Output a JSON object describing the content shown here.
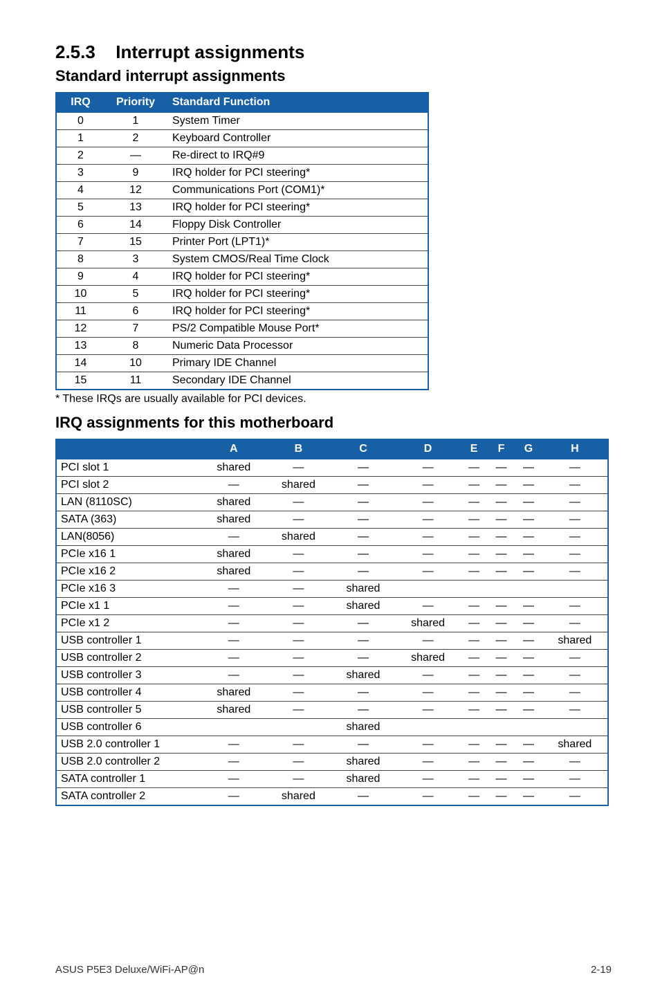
{
  "section": {
    "number": "2.5.3",
    "title": "Interrupt assignments"
  },
  "subhead1": "Standard interrupt assignments",
  "table1": {
    "headers": {
      "irq": "IRQ",
      "priority": "Priority",
      "func": "Standard Function"
    },
    "rows": [
      {
        "irq": "0",
        "pri": "1",
        "func": "System Timer"
      },
      {
        "irq": "1",
        "pri": "2",
        "func": "Keyboard Controller"
      },
      {
        "irq": "2",
        "pri": "—",
        "func": "Re-direct to IRQ#9"
      },
      {
        "irq": "3",
        "pri": "9",
        "func": "IRQ holder for PCI steering*"
      },
      {
        "irq": "4",
        "pri": "12",
        "func": "Communications Port (COM1)*"
      },
      {
        "irq": "5",
        "pri": "13",
        "func": "IRQ holder for PCI steering*"
      },
      {
        "irq": "6",
        "pri": "14",
        "func": "Floppy Disk Controller"
      },
      {
        "irq": "7",
        "pri": "15",
        "func": "Printer Port (LPT1)*"
      },
      {
        "irq": "8",
        "pri": "3",
        "func": "System CMOS/Real Time Clock"
      },
      {
        "irq": "9",
        "pri": "4",
        "func": "IRQ holder for PCI steering*"
      },
      {
        "irq": "10",
        "pri": "5",
        "func": "IRQ holder for PCI steering*"
      },
      {
        "irq": "11",
        "pri": "6",
        "func": "IRQ holder for PCI steering*"
      },
      {
        "irq": "12",
        "pri": "7",
        "func": "PS/2 Compatible Mouse Port*"
      },
      {
        "irq": "13",
        "pri": "8",
        "func": "Numeric Data Processor"
      },
      {
        "irq": "14",
        "pri": "10",
        "func": "Primary IDE Channel"
      },
      {
        "irq": "15",
        "pri": "11",
        "func": "Secondary IDE Channel"
      }
    ]
  },
  "note": "* These IRQs are usually available for PCI devices.",
  "subhead2": "IRQ assignments for this motherboard",
  "table2": {
    "headers": {
      "dev": "",
      "A": "A",
      "B": "B",
      "C": "C",
      "D": "D",
      "E": "E",
      "F": "F",
      "G": "G",
      "H": "H"
    },
    "rows": [
      {
        "dev": "PCI slot 1",
        "A": "shared",
        "B": "—",
        "C": "—",
        "D": "—",
        "E": "—",
        "F": "—",
        "G": "—",
        "H": "—"
      },
      {
        "dev": "PCI slot 2",
        "A": "—",
        "B": "shared",
        "C": "—",
        "D": "—",
        "E": "—",
        "F": "—",
        "G": "—",
        "H": "—"
      },
      {
        "dev": "LAN (8110SC)",
        "A": "shared",
        "B": "—",
        "C": "—",
        "D": "—",
        "E": "—",
        "F": "—",
        "G": "—",
        "H": "—"
      },
      {
        "dev": "SATA (363)",
        "A": "shared",
        "B": "—",
        "C": "—",
        "D": "—",
        "E": "—",
        "F": "—",
        "G": "—",
        "H": "—"
      },
      {
        "dev": "LAN(8056)",
        "A": "—",
        "B": "shared",
        "C": "—",
        "D": "—",
        "E": "—",
        "F": "—",
        "G": "—",
        "H": "—"
      },
      {
        "dev": "PCIe x16 1",
        "A": "shared",
        "B": "—",
        "C": "—",
        "D": "—",
        "E": "—",
        "F": "—",
        "G": "—",
        "H": "—"
      },
      {
        "dev": "PCIe x16 2",
        "A": "shared",
        "B": "—",
        "C": "—",
        "D": "—",
        "E": "—",
        "F": "—",
        "G": "—",
        "H": "—"
      },
      {
        "dev": "PCIe x16 3",
        "A": "—",
        "B": "—",
        "C": "shared",
        "D": "",
        "E": "",
        "F": "",
        "G": "",
        "H": ""
      },
      {
        "dev": "PCIe x1 1",
        "A": "—",
        "B": "—",
        "C": "shared",
        "D": "—",
        "E": "—",
        "F": "—",
        "G": "—",
        "H": "—"
      },
      {
        "dev": "PCIe x1 2",
        "A": "—",
        "B": "—",
        "C": "—",
        "D": "shared",
        "E": "—",
        "F": "—",
        "G": "—",
        "H": "—"
      },
      {
        "dev": "USB controller 1",
        "A": "—",
        "B": "—",
        "C": "—",
        "D": "—",
        "E": "—",
        "F": "—",
        "G": "—",
        "H": "shared"
      },
      {
        "dev": "USB controller 2",
        "A": "—",
        "B": "—",
        "C": "—",
        "D": "shared",
        "E": "—",
        "F": "—",
        "G": "—",
        "H": "—"
      },
      {
        "dev": "USB controller 3",
        "A": "—",
        "B": "—",
        "C": "shared",
        "D": "—",
        "E": "—",
        "F": "—",
        "G": "—",
        "H": "—"
      },
      {
        "dev": "USB controller 4",
        "A": "shared",
        "B": "—",
        "C": "—",
        "D": "—",
        "E": "—",
        "F": "—",
        "G": "—",
        "H": "—"
      },
      {
        "dev": "USB controller 5",
        "A": "shared",
        "B": "—",
        "C": "—",
        "D": "—",
        "E": "—",
        "F": "—",
        "G": "—",
        "H": "—"
      },
      {
        "dev": "USB controller 6",
        "A": "",
        "B": "",
        "C": "shared",
        "D": "",
        "E": "",
        "F": "",
        "G": "",
        "H": ""
      },
      {
        "dev": "USB 2.0 controller 1",
        "A": "—",
        "B": "—",
        "C": "—",
        "D": "—",
        "E": "—",
        "F": "—",
        "G": "—",
        "H": "shared"
      },
      {
        "dev": "USB 2.0 controller 2",
        "A": "—",
        "B": "—",
        "C": "shared",
        "D": "—",
        "E": "—",
        "F": "—",
        "G": "—",
        "H": "—"
      },
      {
        "dev": "SATA controller 1",
        "A": "—",
        "B": "—",
        "C": "shared",
        "D": "—",
        "E": "—",
        "F": "—",
        "G": "—",
        "H": "—"
      },
      {
        "dev": "SATA controller 2",
        "A": "—",
        "B": "shared",
        "C": "—",
        "D": "—",
        "E": "—",
        "F": "—",
        "G": "—",
        "H": "—"
      }
    ]
  },
  "footer": {
    "left": "ASUS P5E3 Deluxe/WiFi-AP@n",
    "right": "2-19"
  }
}
